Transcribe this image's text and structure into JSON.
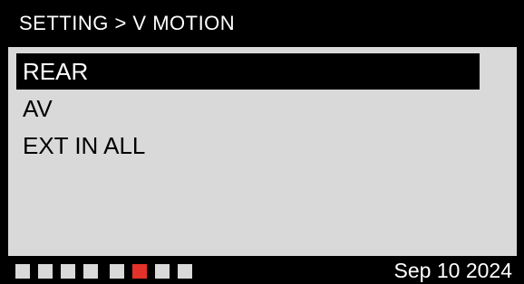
{
  "header": {
    "breadcrumb": "SETTING > V MOTION"
  },
  "menu": {
    "items": [
      {
        "label": "REAR",
        "selected": true
      },
      {
        "label": "AV",
        "selected": false
      },
      {
        "label": "EXT IN ALL",
        "selected": false
      }
    ]
  },
  "footer": {
    "page_indicators": {
      "count": 8,
      "active_index": 5,
      "active_color": "#e4322b",
      "inactive_color": "#d9d9d9"
    },
    "date": "Sep 10 2024"
  },
  "colors": {
    "background": "#000000",
    "panel": "#d9d9d9",
    "selected_bg": "#000000",
    "selected_text": "#ffffff",
    "text": "#000000"
  }
}
